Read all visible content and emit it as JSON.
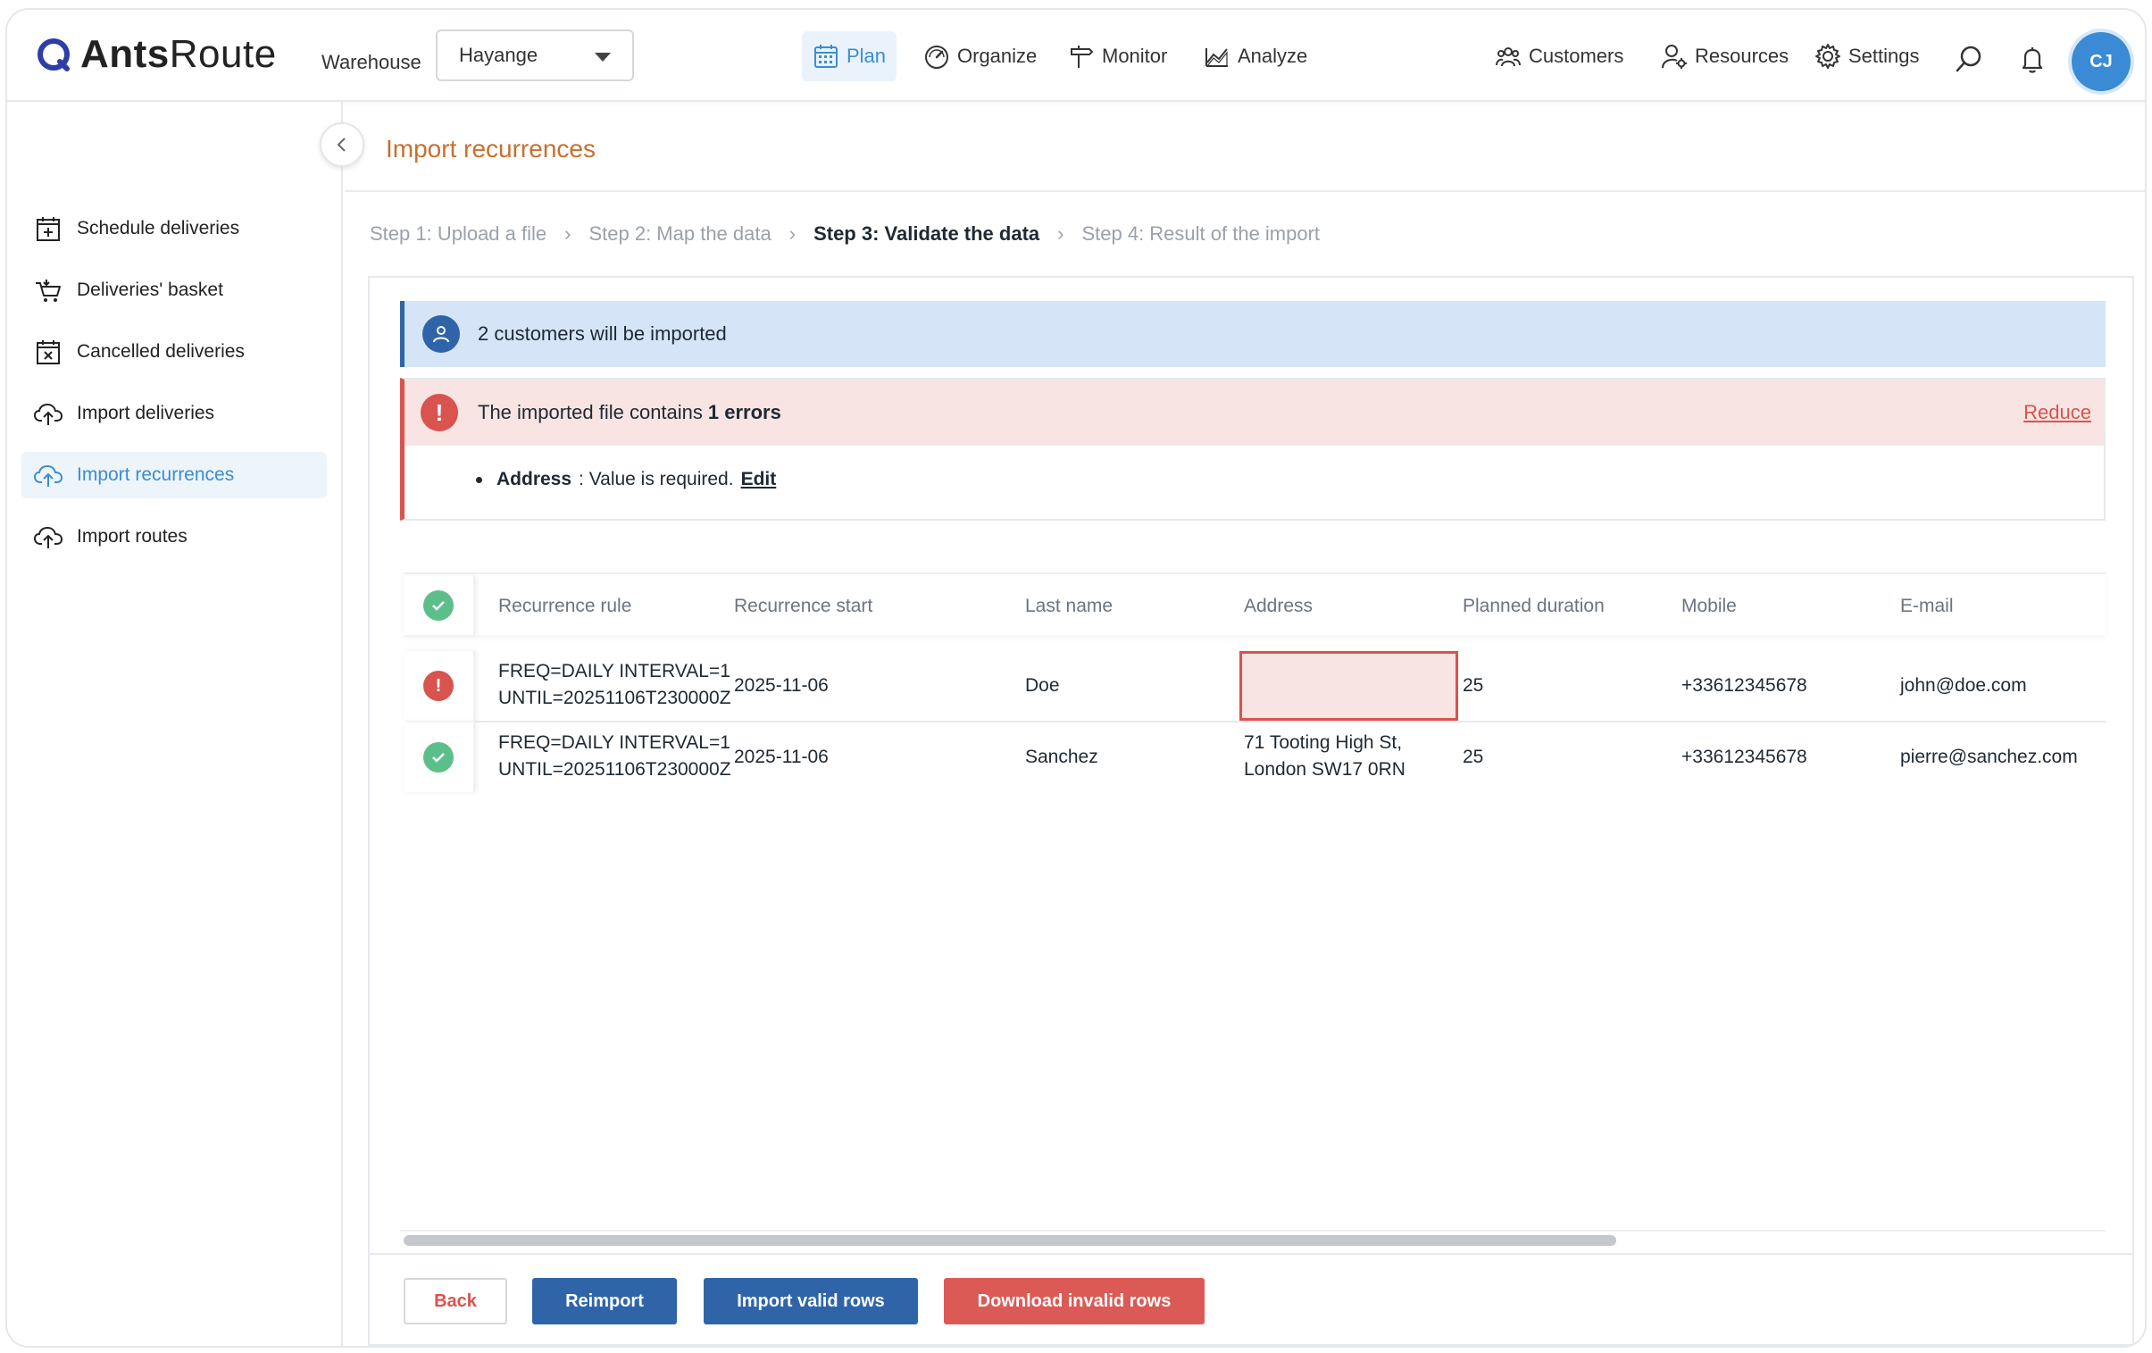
{
  "app": {
    "brand_bold": "Ants",
    "brand_light": "Route",
    "warehouse_label": "Warehouse",
    "warehouse_value": "Hayange",
    "nav": [
      {
        "label": "Plan",
        "icon": "calendar-icon",
        "active": true
      },
      {
        "label": "Organize",
        "icon": "gauge-icon"
      },
      {
        "label": "Monitor",
        "icon": "signpost-icon"
      },
      {
        "label": "Analyze",
        "icon": "chart-icon"
      }
    ],
    "right_nav": [
      {
        "label": "Customers",
        "icon": "customers-icon"
      },
      {
        "label": "Resources",
        "icon": "resources-icon"
      },
      {
        "label": "Settings",
        "icon": "gear-icon"
      }
    ],
    "avatar_initials": "CJ",
    "accent": "#3a8dd3"
  },
  "sidebar": {
    "items": [
      {
        "label": "Schedule deliveries",
        "icon": "calendar-plus-icon"
      },
      {
        "label": "Deliveries' basket",
        "icon": "basket-icon"
      },
      {
        "label": "Cancelled deliveries",
        "icon": "calendar-x-icon"
      },
      {
        "label": "Import deliveries",
        "icon": "cloud-upload-icon"
      },
      {
        "label": "Import recurrences",
        "icon": "cloud-upload-icon",
        "active": true
      },
      {
        "label": "Import routes",
        "icon": "cloud-upload-icon"
      }
    ]
  },
  "page": {
    "title": "Import recurrences",
    "steps": [
      "Step 1: Upload a file",
      "Step 2: Map the data",
      "Step 3: Validate the data",
      "Step 4: Result of the import"
    ],
    "current_step": 2
  },
  "info": {
    "text": "2 customers will be imported"
  },
  "errors": {
    "text_prefix": "The imported file contains",
    "count_text": "1 errors",
    "reduce_label": "Reduce",
    "items": [
      {
        "field": "Address",
        "message": ": Value is required.",
        "edit_label": "Edit"
      }
    ]
  },
  "table": {
    "columns": [
      "Recurrence rule",
      "Recurrence start",
      "Last name",
      "Address",
      "Planned duration",
      "Mobile",
      "E-mail"
    ],
    "rows": [
      {
        "status": "error",
        "rule_line1": "FREQ=DAILY INTERVAL=1",
        "rule_line2": "UNTIL=20251106T230000Z",
        "start": "2025-11-06",
        "last_name": "Doe",
        "address_line1": "",
        "address_line2": "",
        "duration": "25",
        "mobile": "+33612345678",
        "email": "john@doe.com"
      },
      {
        "status": "ok",
        "rule_line1": "FREQ=DAILY INTERVAL=1",
        "rule_line2": "UNTIL=20251106T230000Z",
        "start": "2025-11-06",
        "last_name": "Sanchez",
        "address_line1": "71 Tooting High St,",
        "address_line2": "London SW17 0RN",
        "duration": "25",
        "mobile": "+33612345678",
        "email": "pierre@sanchez.com"
      }
    ]
  },
  "actions": {
    "back": "Back",
    "reimport": "Reimport",
    "import_valid": "Import valid rows",
    "download_invalid": "Download invalid rows"
  }
}
